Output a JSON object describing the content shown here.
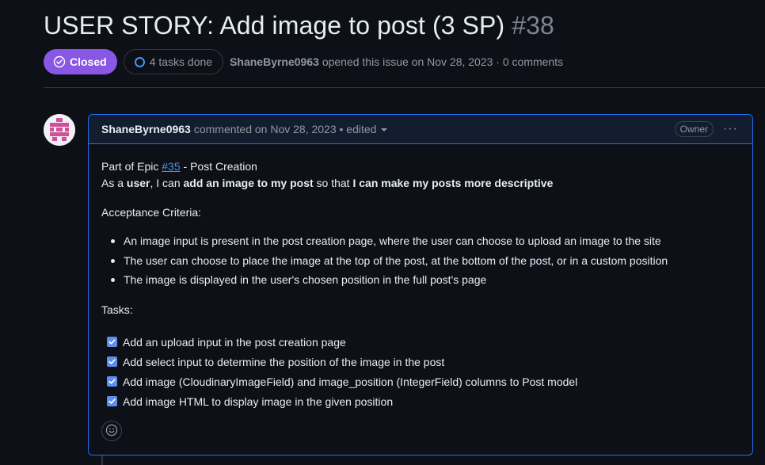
{
  "issue": {
    "title": "USER STORY: Add image to post (3 SP)",
    "number": "#38",
    "state_label": "Closed",
    "tasks_done": "4 tasks done",
    "author": "ShaneByrne0963",
    "opened_text": "opened this issue on Nov 28, 2023 · 0 comments"
  },
  "comment": {
    "author": "ShaneByrne0963",
    "meta": "commented on Nov 28, 2023 • edited",
    "role_badge": "Owner",
    "menu_glyph": "···",
    "epic_prefix": "Part of Epic ",
    "epic_link": "#35",
    "epic_suffix": " - Post Creation",
    "story": {
      "t1": "As a ",
      "b1": "user",
      "t2": ", I can ",
      "b2": "add an image to my post",
      "t3": " so that ",
      "b3": "I can make my posts more descriptive"
    },
    "criteria_heading": "Acceptance Criteria:",
    "criteria": [
      "An image input is present in the post creation page, where the user can choose to upload an image to the site",
      "The user can choose to place the image at the top of the post, at the bottom of the post, or in a custom position",
      "The image is displayed in the user's chosen position in the full post's page"
    ],
    "tasks_heading": "Tasks:",
    "tasks": [
      {
        "label": "Add an upload input in the post creation page",
        "checked": true
      },
      {
        "label": "Add select input to determine the position of the image in the post",
        "checked": true
      },
      {
        "label": "Add image (CloudinaryImageField) and image_position (IntegerField) columns to Post model",
        "checked": true
      },
      {
        "label": "Add image HTML to display image in the given position",
        "checked": true
      }
    ]
  },
  "colors": {
    "closed_badge": "#8957e5",
    "accent_blue": "#4493f8",
    "comment_border": "#1f6feb",
    "background": "#0d1117"
  },
  "icons": [
    "check-circle-icon",
    "progress-ring-icon",
    "caret-down-icon",
    "kebab-icon",
    "checkbox-icon",
    "smiley-icon"
  ]
}
